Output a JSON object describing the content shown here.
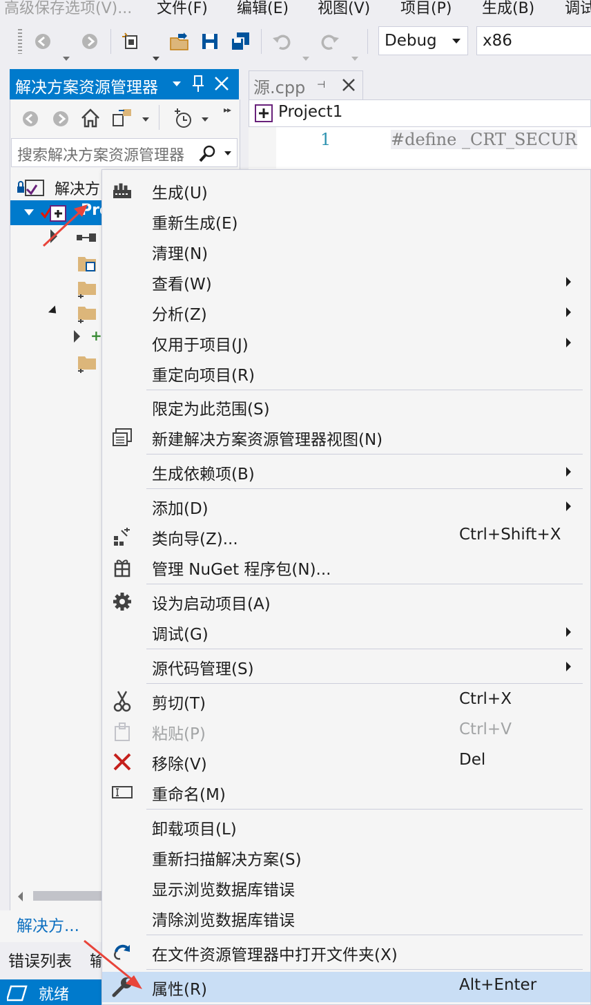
{
  "menubar": {
    "items": [
      "高级保存选项(V)...",
      "文件(F)",
      "编辑(E)",
      "视图(V)",
      "项目(P)",
      "生成(B)",
      "调试"
    ]
  },
  "toolbar": {
    "config": "Debug",
    "platform": "x86"
  },
  "solution_explorer": {
    "title": "解决方案资源管理器",
    "search_placeholder": "搜索解决方案资源管理器",
    "solution_label": "解决方",
    "project_label": "Pro",
    "bottom_tab": "解决方...",
    "error_list": "错误列表",
    "error_list_next": "输"
  },
  "editor": {
    "tab": "源.cpp",
    "project_combo": "Project1",
    "line_number": "1",
    "code": "#define  _CRT_SECUR"
  },
  "status": {
    "text": "就绪"
  },
  "context_menu": {
    "items": [
      {
        "label": "生成(U)",
        "icon": "build-icon"
      },
      {
        "label": "重新生成(E)"
      },
      {
        "label": "清理(N)"
      },
      {
        "label": "查看(W)",
        "submenu": true
      },
      {
        "label": "分析(Z)",
        "submenu": true
      },
      {
        "label": "仅用于项目(J)",
        "submenu": true
      },
      {
        "label": "重定向项目(R)"
      },
      {
        "label": "限定为此范围(S)"
      },
      {
        "label": "新建解决方案资源管理器视图(N)",
        "icon": "new-view-icon"
      },
      {
        "label": "生成依赖项(B)",
        "submenu": true
      },
      {
        "label": "添加(D)",
        "submenu": true
      },
      {
        "label": "类向导(Z)...",
        "shortcut": "Ctrl+Shift+X",
        "icon": "class-wizard-icon"
      },
      {
        "label": "管理 NuGet 程序包(N)...",
        "icon": "nuget-icon"
      },
      {
        "label": "设为启动项目(A)",
        "icon": "gear-icon"
      },
      {
        "label": "调试(G)",
        "submenu": true
      },
      {
        "label": "源代码管理(S)",
        "submenu": true
      },
      {
        "label": "剪切(T)",
        "shortcut": "Ctrl+X",
        "icon": "scissors-icon"
      },
      {
        "label": "粘贴(P)",
        "shortcut": "Ctrl+V",
        "icon": "paste-icon",
        "disabled": true
      },
      {
        "label": "移除(V)",
        "shortcut": "Del",
        "icon": "remove-icon"
      },
      {
        "label": "重命名(M)",
        "icon": "rename-icon"
      },
      {
        "label": "卸载项目(L)"
      },
      {
        "label": "重新扫描解决方案(S)"
      },
      {
        "label": "显示浏览数据库错误"
      },
      {
        "label": "清除浏览数据库错误"
      },
      {
        "label": "在文件资源管理器中打开文件夹(X)",
        "icon": "open-folder-icon"
      },
      {
        "label": "属性(R)",
        "shortcut": "Alt+Enter",
        "icon": "wrench-icon",
        "highlighted": true
      }
    ]
  },
  "colors": {
    "accent": "#007acc",
    "highlight": "#c9def5",
    "annotation_arrow": "#e8443a"
  }
}
